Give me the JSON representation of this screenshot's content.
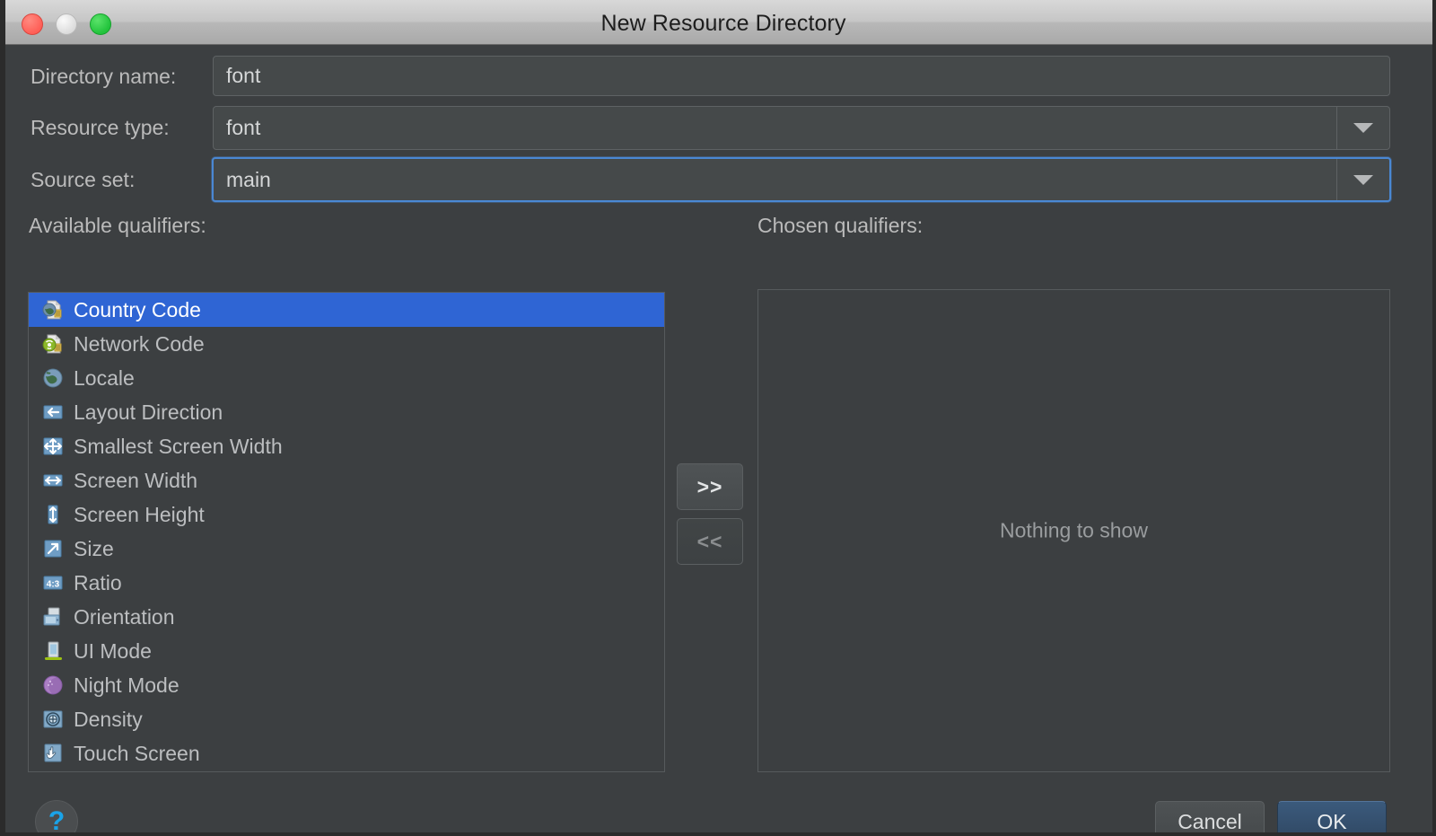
{
  "window": {
    "title": "New Resource Directory",
    "traffic_lights": [
      "close-button",
      "minimize-button",
      "maximize-button"
    ]
  },
  "form": {
    "directory_name": {
      "label": "Directory name:",
      "value": "font",
      "placeholder": ""
    },
    "resource_type": {
      "label": "Resource type:",
      "value": "font",
      "placeholder": ""
    },
    "source_set": {
      "label": "Source set:",
      "value": "main",
      "placeholder": "",
      "focused": true
    }
  },
  "available": {
    "caption": "Available qualifiers:",
    "items": [
      {
        "label": "Country Code",
        "icon": "country-code-icon",
        "selected": true
      },
      {
        "label": "Network Code",
        "icon": "network-code-icon",
        "selected": false
      },
      {
        "label": "Locale",
        "icon": "locale-icon",
        "selected": false
      },
      {
        "label": "Layout Direction",
        "icon": "layout-direction-icon",
        "selected": false
      },
      {
        "label": "Smallest Screen Width",
        "icon": "smallest-screen-width-icon",
        "selected": false
      },
      {
        "label": "Screen Width",
        "icon": "screen-width-icon",
        "selected": false
      },
      {
        "label": "Screen Height",
        "icon": "screen-height-icon",
        "selected": false
      },
      {
        "label": "Size",
        "icon": "size-icon",
        "selected": false
      },
      {
        "label": "Ratio",
        "icon": "ratio-icon",
        "selected": false
      },
      {
        "label": "Orientation",
        "icon": "orientation-icon",
        "selected": false
      },
      {
        "label": "UI Mode",
        "icon": "ui-mode-icon",
        "selected": false
      },
      {
        "label": "Night Mode",
        "icon": "night-mode-icon",
        "selected": false
      },
      {
        "label": "Density",
        "icon": "density-icon",
        "selected": false
      },
      {
        "label": "Touch Screen",
        "icon": "touch-screen-icon",
        "selected": false
      }
    ]
  },
  "chosen": {
    "caption": "Chosen qualifiers:",
    "empty_text": "Nothing to show",
    "items": []
  },
  "transfer": {
    "add_label": ">>",
    "remove_label": "<<",
    "add_enabled": true,
    "remove_enabled": false
  },
  "footer": {
    "help_label": "?",
    "cancel_label": "Cancel",
    "ok_label": "OK"
  },
  "colors": {
    "window_bg": "#3c3f41",
    "field_bg": "#45494a",
    "selection_blue": "#2f65d4",
    "focus_blue": "#4a88d4",
    "ok_blue": "#3b5a7c",
    "help_blue": "#1aa3e8",
    "text": "#bbbbbb",
    "titlebar": "#c6c6c6"
  }
}
